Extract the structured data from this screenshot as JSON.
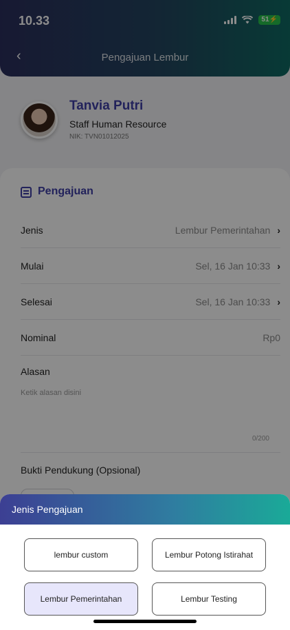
{
  "status_bar": {
    "time": "10.33",
    "battery": "51"
  },
  "header": {
    "title": "Pengajuan Lembur"
  },
  "profile": {
    "name": "Tanvia Putri",
    "role": "Staff Human Resource",
    "nik": "NIK: TVN01012025"
  },
  "form": {
    "section_title": "Pengajuan",
    "rows": [
      {
        "label": "Jenis",
        "value": "Lembur Pemerintahan"
      },
      {
        "label": "Mulai",
        "value": "Sel, 16 Jan 10:33"
      },
      {
        "label": "Selesai",
        "value": "Sel, 16 Jan 10:33"
      },
      {
        "label": "Nominal",
        "value": "Rp0"
      }
    ],
    "alasan": {
      "label": "Alasan",
      "placeholder": "Ketik alasan disini",
      "counter": "0/200"
    },
    "bukti": {
      "label": "Bukti Pendukung (Opsional)"
    }
  },
  "sheet": {
    "title": "Jenis Pengajuan",
    "options": [
      {
        "label": "lembur custom",
        "selected": false
      },
      {
        "label": "Lembur Potong Istirahat",
        "selected": false
      },
      {
        "label": "Lembur Pemerintahan",
        "selected": true
      },
      {
        "label": "Lembur Testing",
        "selected": false
      }
    ]
  }
}
